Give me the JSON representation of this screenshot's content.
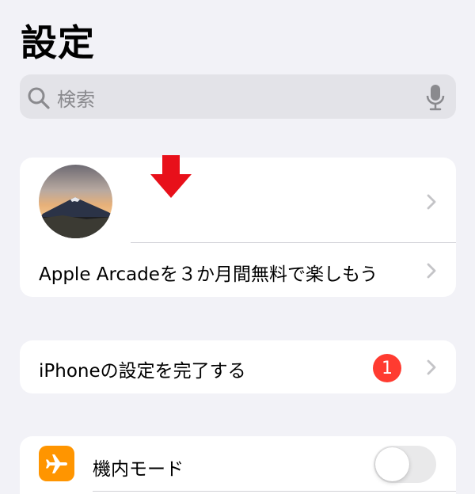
{
  "header": {
    "title": "設定"
  },
  "search": {
    "placeholder": "検索",
    "icon": "search-icon",
    "mic_icon": "microphone-icon"
  },
  "profile": {
    "avatar_icon": "mountain-sunset-avatar",
    "indicator": "red-down-arrow",
    "arcade_promo": "Apple Arcadeを３か月間無料で楽しもう"
  },
  "setup": {
    "label": "iPhoneの設定を完了する",
    "badge_count": "1"
  },
  "settings": {
    "items": [
      {
        "label": "機内モード",
        "icon": "airplane-icon",
        "toggle_on": false
      }
    ]
  },
  "colors": {
    "background": "#f2f2f7",
    "card": "#ffffff",
    "badge": "#ff3b30",
    "airplane_icon_bg": "#ff9500",
    "indicator_arrow": "#e8101a",
    "chevron": "#c4c4c7"
  }
}
